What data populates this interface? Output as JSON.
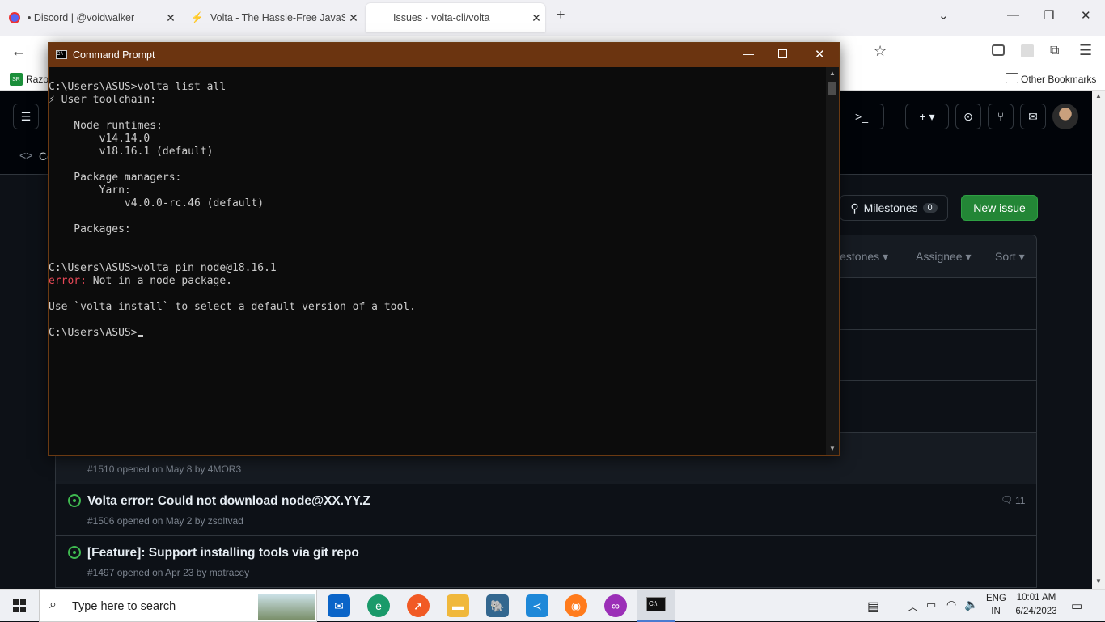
{
  "browser": {
    "tabs": [
      {
        "icon": "discord-icon",
        "label": "• Discord | @voidwalker"
      },
      {
        "icon": "bolt-icon",
        "label": "Volta - The Hassle-Free JavaScri"
      },
      {
        "icon": "github-icon",
        "label": "Issues · volta-cli/volta"
      }
    ],
    "bookmark_left": "Razo",
    "bookmark_right": "Other Bookmarks"
  },
  "github": {
    "header_tab": "Co",
    "milestones_label": "Milestones",
    "milestones_count": "0",
    "new_issue": "New issue",
    "filters": [
      "lestones ▾",
      "Assignee ▾",
      "Sort ▾"
    ],
    "issues": [
      {
        "title": "",
        "meta": "#1510 opened on May 8 by 4MOR3",
        "comments": ""
      },
      {
        "title": "Volta error: Could not download node@XX.YY.Z",
        "meta": "#1506 opened on May 2 by zsoltvad",
        "comments": "11"
      },
      {
        "title": "[Feature]: Support installing tools via git repo",
        "meta": "#1497 opened on Apr 23 by matracey",
        "comments": ""
      }
    ]
  },
  "cmd": {
    "title": "Command Prompt",
    "lines": [
      {
        "text": "C:\\Users\\ASUS>volta list all",
        "err": ""
      },
      {
        "text": "⚡ User toolchain:",
        "err": ""
      },
      {
        "text": "",
        "err": ""
      },
      {
        "text": "    Node runtimes:",
        "err": ""
      },
      {
        "text": "        v14.14.0",
        "err": ""
      },
      {
        "text": "        v18.16.1 (default)",
        "err": ""
      },
      {
        "text": "",
        "err": ""
      },
      {
        "text": "    Package managers:",
        "err": ""
      },
      {
        "text": "        Yarn:",
        "err": ""
      },
      {
        "text": "            v4.0.0-rc.46 (default)",
        "err": ""
      },
      {
        "text": "",
        "err": ""
      },
      {
        "text": "    Packages:",
        "err": ""
      },
      {
        "text": "",
        "err": ""
      },
      {
        "text": "",
        "err": ""
      },
      {
        "text": "C:\\Users\\ASUS>volta pin node@18.16.1",
        "err": ""
      },
      {
        "text": " Not in a node package.",
        "err": "error:"
      },
      {
        "text": "",
        "err": ""
      },
      {
        "text": "Use `volta install` to select a default version of a tool.",
        "err": ""
      },
      {
        "text": "",
        "err": ""
      },
      {
        "text": "C:\\Users\\ASUS>",
        "err": ""
      }
    ]
  },
  "taskbar": {
    "search_placeholder": "Type here to search",
    "lang": "ENG",
    "region": "IN",
    "time": "10:01 AM",
    "date": "6/24/2023"
  }
}
